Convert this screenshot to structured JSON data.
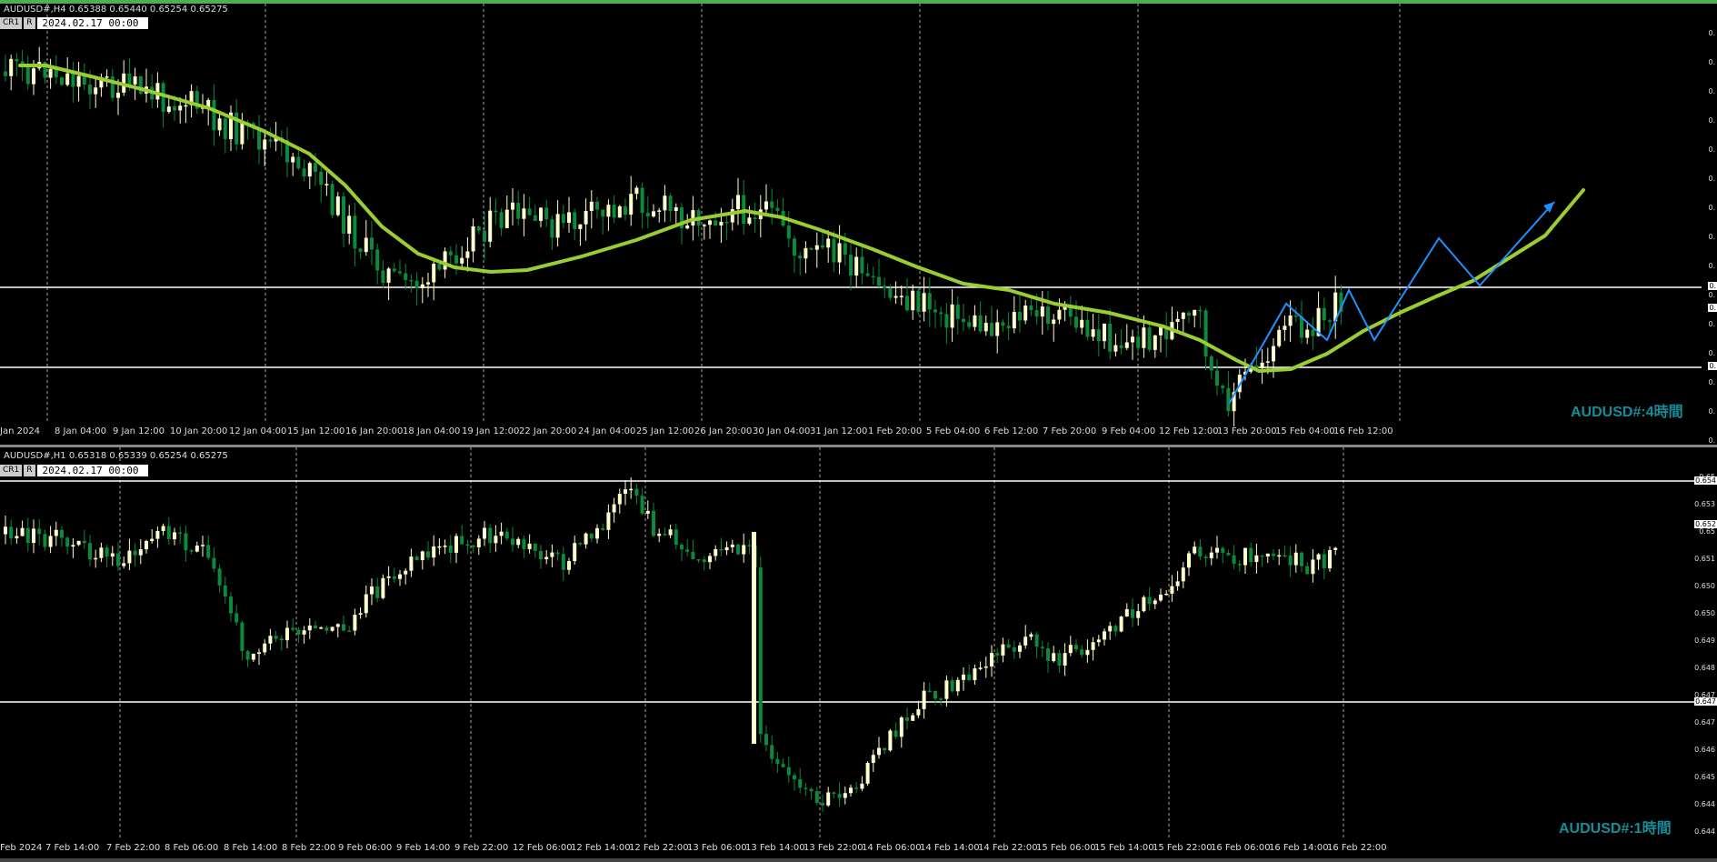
{
  "top_pane": {
    "info": "AUDUSD#,H4  0.65388 0.65440 0.65254 0.65275",
    "buttons": [
      "CR1",
      "R"
    ],
    "datetime": "2024.02.17 00:00",
    "label": "AUDUSD#:4時間",
    "x_labels": [
      "Jan 2024",
      "8 Jan 04:00",
      "9 Jan 12:00",
      "10 Jan 20:00",
      "12 Jan 04:00",
      "15 Jan 12:00",
      "16 Jan 20:00",
      "18 Jan 04:00",
      "19 Jan 12:00",
      "22 Jan 20:00",
      "24 Jan 04:00",
      "25 Jan 12:00",
      "26 Jan 20:00",
      "30 Jan 04:00",
      "31 Jan 12:00",
      "1 Feb 20:00",
      "5 Feb 04:00",
      "6 Feb 12:00",
      "7 Feb 20:00",
      "9 Feb 04:00",
      "12 Feb 12:00",
      "13 Feb 20:00",
      "15 Feb 04:00",
      "16 Feb 12:00"
    ],
    "y_ticks": [
      "0.",
      "0.",
      "0.",
      "0.",
      "0.",
      "0.",
      "0.",
      "0.",
      "0.",
      "0.",
      "0.",
      "0.",
      "0.",
      "0.",
      "0."
    ],
    "y_badges": [
      "0.",
      "0.",
      "0."
    ]
  },
  "bottom_pane": {
    "info": "AUDUSD#,H1  0.65318 0.65339 0.65254 0.65275",
    "buttons": [
      "CR1",
      "R"
    ],
    "datetime": "2024.02.17 00:00",
    "label": "AUDUSD#:1時間",
    "x_labels": [
      "Feb 2024",
      "7 Feb 14:00",
      "7 Feb 22:00",
      "8 Feb 06:00",
      "8 Feb 14:00",
      "8 Feb 22:00",
      "9 Feb 06:00",
      "9 Feb 14:00",
      "9 Feb 22:00",
      "12 Feb 06:00",
      "12 Feb 14:00",
      "12 Feb 22:00",
      "13 Feb 06:00",
      "13 Feb 14:00",
      "13 Feb 22:00",
      "14 Feb 06:00",
      "14 Feb 14:00",
      "14 Feb 22:00",
      "15 Feb 06:00",
      "15 Feb 14:00",
      "15 Feb 22:00",
      "16 Feb 06:00",
      "16 Feb 14:00",
      "16 Feb 22:00"
    ],
    "y_ticks": [
      "0.65",
      "0.653",
      "0.65",
      "0.651",
      "0.650",
      "0.650",
      "0.649",
      "0.648",
      "0.647",
      "0.647",
      "0.646",
      "0.645",
      "0.644",
      "0.644"
    ],
    "y_badges": [
      "0.654",
      "0.652",
      "0.647"
    ]
  },
  "colors": {
    "bull": "#ffffcc",
    "bear": "#0a8a3a",
    "ma": "#9acd32",
    "projection": "#1e90ff",
    "hline": "#ffffff",
    "label": "#138e9a",
    "frame_top": "#4caf50"
  }
}
